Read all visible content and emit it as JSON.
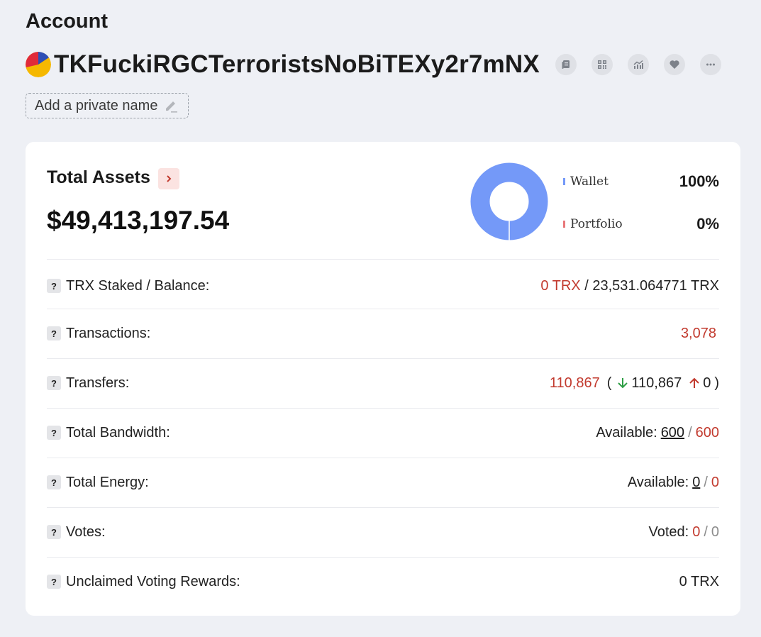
{
  "page": {
    "title": "Account"
  },
  "account": {
    "address": "TKFuckiRGCTerroristsNoBiTEXy2r7mNX",
    "private_name_placeholder": "Add a private name"
  },
  "assets": {
    "title": "Total Assets",
    "value": "$49,413,197.54",
    "legend": [
      {
        "label": "Wallet",
        "percent": "100%",
        "color": "#7499f8"
      },
      {
        "label": "Portfolio",
        "percent": "0%",
        "color": "#e8787a"
      }
    ]
  },
  "rows": {
    "trx": {
      "label": "TRX Staked / Balance:",
      "staked": "0 TRX",
      "sep": " / ",
      "balance": "23,531.064771 TRX"
    },
    "transactions": {
      "label": "Transactions:",
      "value": "3,078"
    },
    "transfers": {
      "label": "Transfers:",
      "total": "110,867",
      "open": "(",
      "in": "110,867",
      "out": "0",
      "close": ")"
    },
    "bandwidth": {
      "label": "Total Bandwidth:",
      "prefix": "Available:",
      "available": "600",
      "sep": "/",
      "total": "600"
    },
    "energy": {
      "label": "Total Energy:",
      "prefix": "Available:",
      "available": "0",
      "sep": "/",
      "total": "0"
    },
    "votes": {
      "label": "Votes:",
      "prefix": "Voted:",
      "voted": "0",
      "sep": "/",
      "total": "0"
    },
    "rewards": {
      "label": "Unclaimed Voting Rewards:",
      "value": "0 TRX"
    }
  },
  "help_icon": "?",
  "colors": {
    "accent_red": "#c23a2e",
    "green": "#2e9e45",
    "donut": "#7499f8"
  },
  "icons": [
    "copy-icon",
    "qr-code-icon",
    "chart-icon",
    "heart-icon",
    "more-icon",
    "edit-pencil-icon",
    "chevron-right-icon",
    "arrow-down-icon",
    "arrow-up-icon",
    "help-icon"
  ]
}
